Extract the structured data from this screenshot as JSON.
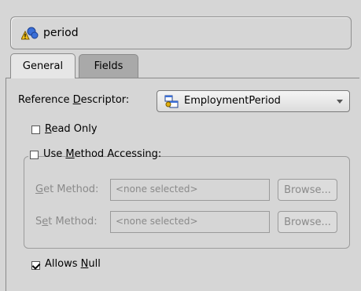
{
  "header": {
    "title": "period",
    "icon": "mapping-warning-icon"
  },
  "tabs": [
    {
      "label": "General",
      "selected": true
    },
    {
      "label": "Fields",
      "selected": false
    }
  ],
  "general": {
    "reference_descriptor": {
      "label_pre": "Reference ",
      "label_mnemonic": "D",
      "label_post": "escriptor:",
      "value": "EmploymentPeriod",
      "icon": "descriptor-icon"
    },
    "read_only": {
      "label_mnemonic": "R",
      "label_post": "ead Only",
      "checked": false
    },
    "use_method_accessing": {
      "label_pre": "Use ",
      "label_mnemonic": "M",
      "label_post": "ethod Accessing:",
      "checked": false
    },
    "get_method": {
      "label_mnemonic": "G",
      "label_post": "et Method:",
      "value": "<none selected>",
      "button": "Browse...",
      "enabled": false
    },
    "set_method": {
      "label_pre": "S",
      "label_mnemonic": "e",
      "label_post": "t Method:",
      "value": "<none selected>",
      "button": "Browse...",
      "enabled": false
    },
    "allows_null": {
      "label_pre": "Allows ",
      "label_mnemonic": "N",
      "label_post": "ull",
      "checked": true
    }
  },
  "colors": {
    "panel": "#d6d6d6",
    "tab_inactive": "#a9a9a9",
    "disabled_text": "#8a8a8a"
  }
}
